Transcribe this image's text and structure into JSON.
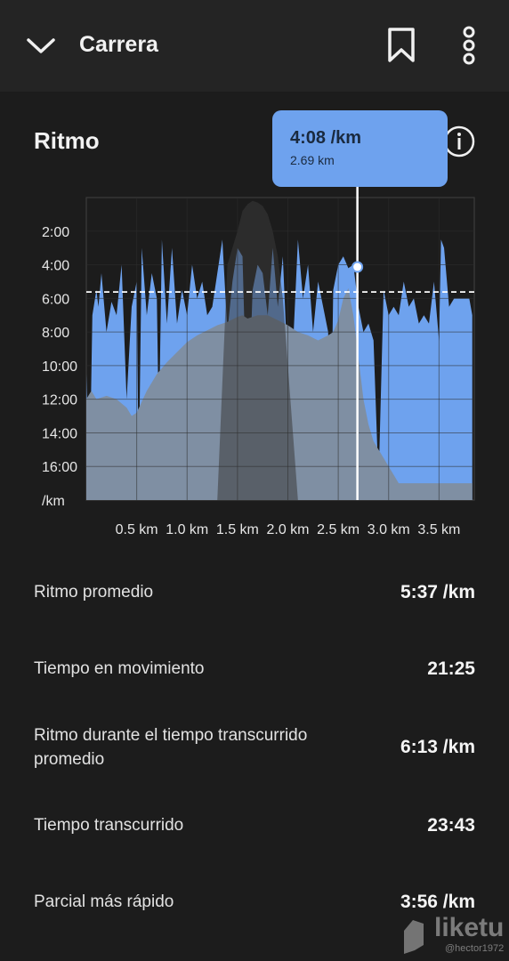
{
  "header": {
    "title": "Carrera"
  },
  "section": {
    "title": "Ritmo"
  },
  "tooltip": {
    "pace": "4:08 /km",
    "distance": "2.69 km"
  },
  "chart_data": {
    "type": "area",
    "y_ticks": [
      "2:00",
      "4:00",
      "6:00",
      "8:00",
      "10:00",
      "12:00",
      "14:00",
      "16:00",
      "/km"
    ],
    "x_ticks": [
      "0.5 km",
      "1.0 km",
      "1.5 km",
      "2.0 km",
      "2.5 km",
      "3.0 km",
      "3.5 km"
    ],
    "x_range_km": [
      0,
      3.85
    ],
    "y_range_min_per_km": [
      0,
      18
    ],
    "y_reversed": true,
    "average_pace_min": 5.62,
    "cursor": {
      "x_km": 2.69,
      "pace_min": 4.13
    },
    "series": [
      {
        "color": "#6ea2ee",
        "x": [
          0.0,
          0.03,
          0.06,
          0.1,
          0.12,
          0.15,
          0.2,
          0.25,
          0.3,
          0.35,
          0.4,
          0.45,
          0.5,
          0.52,
          0.55,
          0.6,
          0.65,
          0.7,
          0.72,
          0.75,
          0.8,
          0.85,
          0.9,
          0.95,
          1.0,
          1.05,
          1.1,
          1.15,
          1.2,
          1.25,
          1.3,
          1.35,
          1.4,
          1.45,
          1.5,
          1.55,
          1.6,
          1.65,
          1.7,
          1.75,
          1.8,
          1.85,
          1.9,
          1.95,
          2.0,
          2.05,
          2.1,
          2.15,
          2.2,
          2.25,
          2.3,
          2.35,
          2.4,
          2.42,
          2.45,
          2.5,
          2.55,
          2.6,
          2.65,
          2.7,
          2.75,
          2.8,
          2.85,
          2.9,
          2.95,
          3.0,
          3.05,
          3.1,
          3.15,
          3.2,
          3.25,
          3.3,
          3.35,
          3.4,
          3.45,
          3.5,
          3.52,
          3.55,
          3.6,
          3.65,
          3.7,
          3.75,
          3.8,
          3.83
        ],
        "values": [
          10.5,
          17.8,
          7.0,
          5.5,
          6.5,
          4.5,
          8.0,
          6.2,
          7.0,
          4.0,
          12.0,
          6.5,
          5.0,
          16.8,
          3.0,
          7.0,
          4.5,
          6.0,
          14.0,
          2.5,
          7.5,
          3.0,
          7.5,
          5.5,
          7.0,
          4.0,
          6.0,
          5.0,
          7.0,
          6.5,
          4.5,
          2.5,
          8.0,
          5.0,
          3.0,
          3.5,
          14.5,
          5.5,
          4.0,
          4.5,
          7.0,
          3.0,
          6.5,
          3.5,
          10.5,
          9.0,
          2.5,
          6.0,
          4.0,
          8.0,
          5.0,
          6.5,
          8.0,
          17.5,
          5.5,
          4.0,
          3.5,
          4.2,
          4.0,
          6.5,
          8.0,
          7.5,
          8.5,
          17.0,
          5.5,
          7.0,
          6.5,
          7.0,
          5.0,
          6.5,
          6.0,
          7.5,
          7.0,
          7.5,
          5.0,
          8.5,
          2.5,
          3.0,
          6.5,
          6.0,
          6.0,
          6.0,
          6.0,
          7.0
        ]
      },
      {
        "color": "#7f8fa3",
        "x": [
          0.0,
          0.05,
          0.1,
          0.2,
          0.3,
          0.4,
          0.45,
          0.5,
          0.6,
          0.7,
          0.8,
          0.9,
          1.0,
          1.1,
          1.2,
          1.3,
          1.4,
          1.5,
          1.55,
          1.6,
          1.7,
          1.8,
          1.9,
          2.0,
          2.1,
          2.2,
          2.3,
          2.4,
          2.45,
          2.5,
          2.55,
          2.6,
          2.65,
          2.7,
          2.75,
          2.8,
          2.85,
          2.9,
          2.95,
          3.0,
          3.05,
          3.1,
          3.2,
          3.3,
          3.4,
          3.5,
          3.6,
          3.7,
          3.8,
          3.83
        ],
        "values": [
          12.0,
          11.5,
          12.0,
          11.8,
          12.0,
          12.5,
          13.0,
          12.8,
          11.5,
          10.5,
          9.8,
          9.2,
          8.6,
          8.2,
          7.9,
          7.6,
          7.4,
          7.1,
          7.0,
          7.2,
          7.0,
          7.0,
          7.3,
          7.6,
          8.0,
          8.2,
          8.5,
          8.2,
          8.0,
          7.3,
          6.0,
          5.4,
          7.0,
          9.5,
          12.0,
          13.5,
          14.5,
          15.0,
          15.5,
          16.0,
          16.5,
          17.0,
          17.0,
          17.0,
          17.0,
          17.0,
          17.0,
          17.0,
          17.0,
          17.0
        ]
      },
      {
        "color": "#3a3a3a",
        "x": [
          1.3,
          1.4,
          1.5,
          1.55,
          1.6,
          1.65,
          1.7,
          1.75,
          1.8,
          1.85,
          1.9,
          1.95,
          2.0,
          2.05,
          2.1
        ],
        "values": [
          18.0,
          4.0,
          2.0,
          0.8,
          0.4,
          0.2,
          0.3,
          0.5,
          1.0,
          2.0,
          3.5,
          6.0,
          10.0,
          14.0,
          18.0
        ]
      }
    ]
  },
  "stats": [
    {
      "label": "Ritmo promedio",
      "value": "5:37 /km"
    },
    {
      "label": "Tiempo en movimiento",
      "value": "21:25"
    },
    {
      "label": "Ritmo durante el tiempo transcurrido promedio",
      "value": "6:13 /km"
    },
    {
      "label": "Tiempo transcurrido",
      "value": "23:43"
    },
    {
      "label": "Parcial más rápido",
      "value": "3:56 /km"
    }
  ],
  "watermark": {
    "brand": "liketu",
    "user": "@hector1972"
  }
}
